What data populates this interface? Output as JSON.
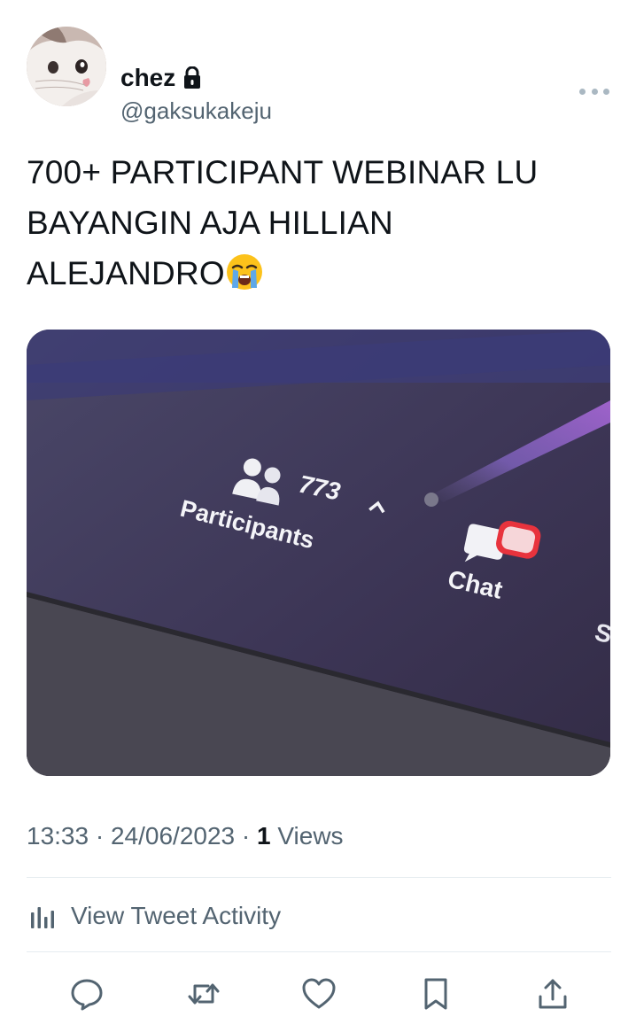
{
  "author": {
    "display_name": "chez",
    "handle": "@gaksukakeju",
    "avatar": "cat-avatar",
    "protected_icon": "lock-icon"
  },
  "tweet": {
    "text": "700+ PARTICIPANT WEBINAR LU\nBAYANGIN AJA HILLIAN\nALEJANDRO",
    "emoji": "loudly-crying-face",
    "media": {
      "participants_count": "773",
      "participants_label": "Participants",
      "chat_label": "Chat",
      "partial_label": "S"
    }
  },
  "meta": {
    "time": "13:33",
    "separator": "·",
    "date": "24/06/2023",
    "views_count": "1",
    "views_label": "Views"
  },
  "activity": {
    "label": "View Tweet Activity",
    "icon": "bar-chart-icon"
  },
  "actions": [
    {
      "name": "reply",
      "icon": "speech-bubble-icon"
    },
    {
      "name": "retweet",
      "icon": "retweet-arrows-icon"
    },
    {
      "name": "like",
      "icon": "heart-icon"
    },
    {
      "name": "bookmark",
      "icon": "bookmark-icon"
    },
    {
      "name": "share",
      "icon": "share-upload-icon"
    }
  ],
  "colors": {
    "text_primary": "#0f1419",
    "text_secondary": "#536471",
    "divider": "#e6ecf0"
  }
}
